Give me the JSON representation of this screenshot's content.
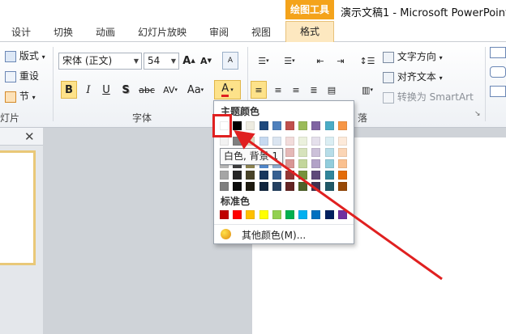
{
  "window": {
    "contextual_tab": "绘图工具",
    "title": "演示文稿1 - Microsoft PowerPoint"
  },
  "tabs": [
    {
      "label": "设计"
    },
    {
      "label": "切换"
    },
    {
      "label": "动画"
    },
    {
      "label": "幻灯片放映"
    },
    {
      "label": "审阅"
    },
    {
      "label": "视图"
    },
    {
      "label": "格式"
    }
  ],
  "ribbon": {
    "slides_group": {
      "layout_label": "版式",
      "reset_label": "重设",
      "section_label": "节",
      "group_label": "灯片"
    },
    "font_group": {
      "font_name": "宋体 (正文)",
      "font_size": "54",
      "bold": "B",
      "italic": "I",
      "underline": "U",
      "shadow": "S",
      "strikethrough": "abc",
      "spacing": "AV",
      "case": "Aa",
      "font_color": "A",
      "group_label": "字体"
    },
    "paragraph_group": {
      "text_direction": "文字方向",
      "align_text": "对齐文本",
      "convert_smartart": "转换为 SmartArt",
      "group_label_partial": "落"
    }
  },
  "color_menu": {
    "theme_title": "主题颜色",
    "theme_top_row": [
      "#ffffff",
      "#000000",
      "#eeece1",
      "#1f497d",
      "#4f81bd",
      "#c0504d",
      "#9bbb59",
      "#8064a2",
      "#4bacc6",
      "#f79646"
    ],
    "theme_shades": [
      [
        "#f2f2f2",
        "#7f7f7f",
        "#ddd9c3",
        "#c6d9f0",
        "#dbe5f1",
        "#f2dcdb",
        "#ebf1dd",
        "#e5e0ec",
        "#dbeef3",
        "#fdeada"
      ],
      [
        "#d8d8d8",
        "#595959",
        "#c4bd97",
        "#8db3e2",
        "#b8cce4",
        "#e5b9b7",
        "#d7e3bc",
        "#ccc1d9",
        "#b7dde8",
        "#fbd5b5"
      ],
      [
        "#bfbfbf",
        "#3f3f3f",
        "#938953",
        "#548dd4",
        "#95b3d7",
        "#d99694",
        "#c3d69b",
        "#b2a2c7",
        "#92cddc",
        "#fac08f"
      ],
      [
        "#a5a5a5",
        "#262626",
        "#494429",
        "#17365d",
        "#366092",
        "#953734",
        "#76923c",
        "#5f497a",
        "#31859b",
        "#e36c09"
      ],
      [
        "#7f7f7f",
        "#0c0c0c",
        "#1d1b10",
        "#0f243e",
        "#244061",
        "#632423",
        "#4f6128",
        "#3f3151",
        "#205867",
        "#974806"
      ]
    ],
    "standard_title": "标准色",
    "standard_colors": [
      "#c00000",
      "#ff0000",
      "#ffc000",
      "#ffff00",
      "#92d050",
      "#00b050",
      "#00b0f0",
      "#0070c0",
      "#002060",
      "#7030a0"
    ],
    "tooltip": "白色, 背景 1",
    "more_colors": "其他颜色(M)..."
  },
  "colors": {
    "accent_highlight": "#e02020",
    "contextual_tab": "#f4a31b"
  }
}
